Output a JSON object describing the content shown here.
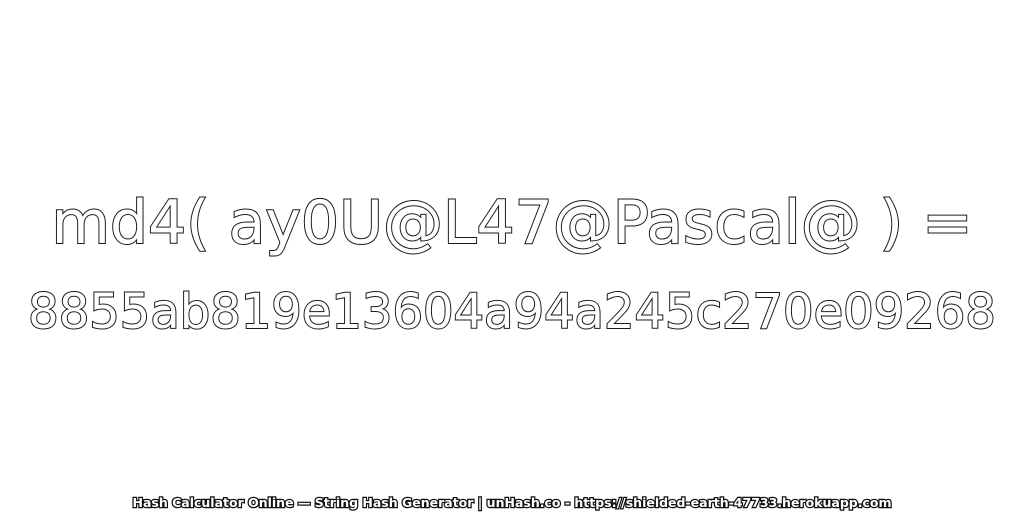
{
  "main": {
    "expression": "md4( ay0U@L47@Pascal@ ) =",
    "hash_value": "8855ab819e13604a94a245c270e09268"
  },
  "footer": {
    "text": "Hash Calculator Online — String Hash Generator | unHash.co - https://shielded-earth-47733.herokuapp.com"
  },
  "colors": {
    "text_fill": "#ffffff",
    "text_outline": "#1a1a1a",
    "background": "#ffffff"
  }
}
